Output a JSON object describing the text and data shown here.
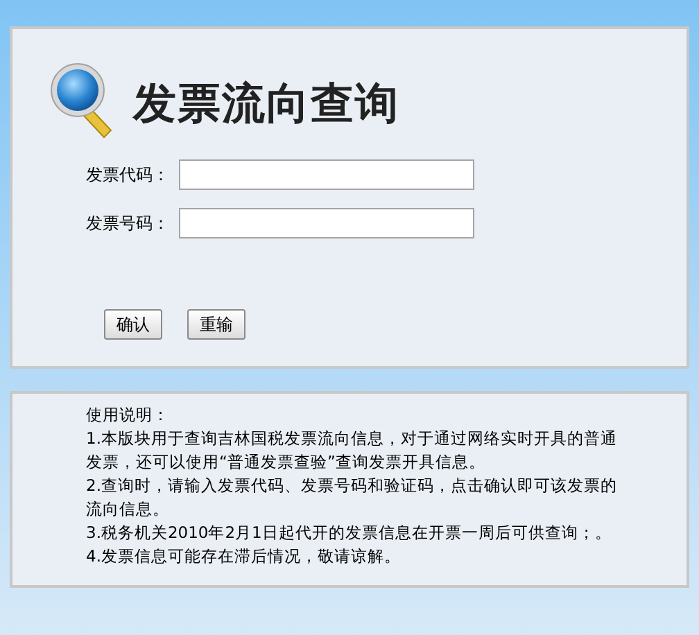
{
  "title": "发票流向查询",
  "fields": [
    {
      "label": "发票代码："
    },
    {
      "label": "发票号码："
    }
  ],
  "buttons": [
    "确认",
    "重输"
  ],
  "instructions": {
    "heading": "使用说明：",
    "items": [
      "1.本版块用于查询吉林国税发票流向信息，对于通过网络实时开具的普通发票，还可以使用“普通发票查验”查询发票开具信息。",
      "2.查询时，请输入发票代码、发票号码和验证码，点击确认即可该发票的流向信息。",
      "3.税务机关2010年2月1日起代开的发票信息在开票一周后可供查询；。",
      "4.发票信息可能存在滞后情况，敬请谅解。"
    ]
  }
}
